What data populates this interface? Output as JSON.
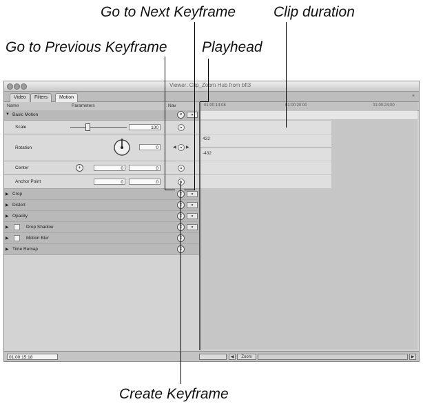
{
  "callouts": {
    "next_keyframe": "Go to Next Keyframe",
    "clip_duration": "Clip duration",
    "prev_keyframe": "Go to Previous Keyframe",
    "playhead": "Playhead",
    "create_keyframe": "Create Keyframe"
  },
  "window": {
    "title": "Viewer: Clip_Zoom Hub from bft3",
    "tabs": [
      "Video",
      "Filters",
      "Motion"
    ],
    "active_tab": "Motion"
  },
  "columns": {
    "name": "Name",
    "parameters": "Parameters",
    "nav": "Nav"
  },
  "timecodes": [
    "01:00:14:08",
    "01:00:20:00",
    "01:00:24:00"
  ],
  "basic_motion": {
    "label": "Basic Motion",
    "scale": {
      "label": "Scale",
      "value": "100"
    },
    "rotation": {
      "label": "Rotation",
      "value": "0",
      "curve_top": "432",
      "curve_bottom": "-432"
    },
    "center": {
      "label": "Center",
      "x": "0",
      "y": "0"
    },
    "anchor_point": {
      "label": "Anchor Point",
      "x": "0",
      "y": "0"
    }
  },
  "sections": [
    {
      "label": "Crop"
    },
    {
      "label": "Distort"
    },
    {
      "label": "Opacity"
    },
    {
      "label": "Drop Shadow",
      "checkbox": true
    },
    {
      "label": "Motion Blur",
      "checkbox": true
    },
    {
      "label": "Time Remap"
    }
  ],
  "bottom": {
    "current_timecode": "01:00:15:18",
    "zoom_label": "Zoom"
  },
  "icons": {
    "reset": "reset-x-icon",
    "keyframe": "create-keyframe-icon",
    "prev": "prev-keyframe-icon",
    "next": "next-keyframe-icon",
    "popup": "keyframe-popup-icon"
  }
}
